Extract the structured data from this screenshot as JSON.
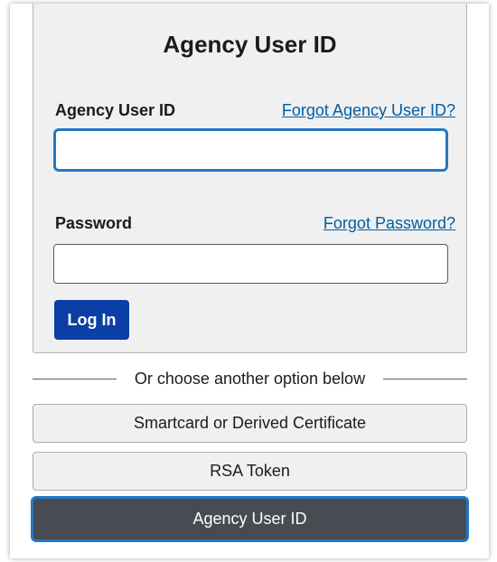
{
  "login_card": {
    "title": "Agency User ID",
    "user_id_label": "Agency User ID",
    "forgot_user_id_link": "Forgot Agency User ID?",
    "user_id_value": "",
    "password_label": "Password",
    "forgot_password_link": "Forgot Password?",
    "password_value": "",
    "login_button": "Log In"
  },
  "divider_text": "Or choose another option below",
  "options": {
    "smartcard": "Smartcard or Derived Certificate",
    "rsa_token": "RSA Token",
    "agency_user_id": "Agency User ID"
  },
  "colors": {
    "link": "#005ea2",
    "primary_button": "#0b3fa6",
    "focus_ring": "#2378c3",
    "active_option_bg": "#474b52",
    "card_bg": "#f0f0f0"
  }
}
